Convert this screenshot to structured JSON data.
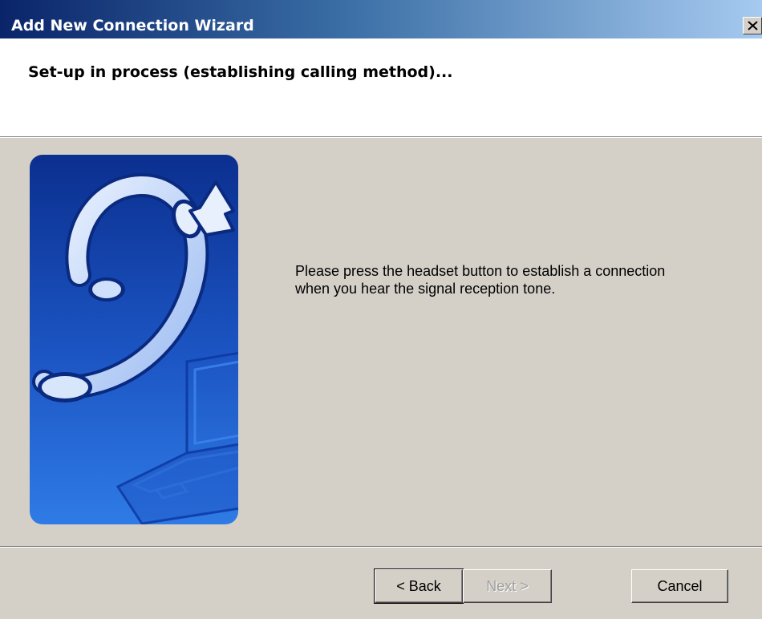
{
  "window": {
    "title": "Add New Connection Wizard"
  },
  "header": {
    "title": "Set-up in process (establishing calling method)..."
  },
  "illustration": {
    "icon": "headset-laptop-illustration",
    "colors": {
      "panel_dark": "#0b2f8f",
      "panel_light": "#2a75e0",
      "headset_light": "#dfeafc",
      "headset_mid": "#a9c6f5"
    }
  },
  "body": {
    "message_line1": "Please press the headset button to establish a connection",
    "message_line2": "when you hear the signal reception tone."
  },
  "buttons": {
    "back_label": "< Back",
    "next_label": "Next >",
    "cancel_label": "Cancel"
  }
}
